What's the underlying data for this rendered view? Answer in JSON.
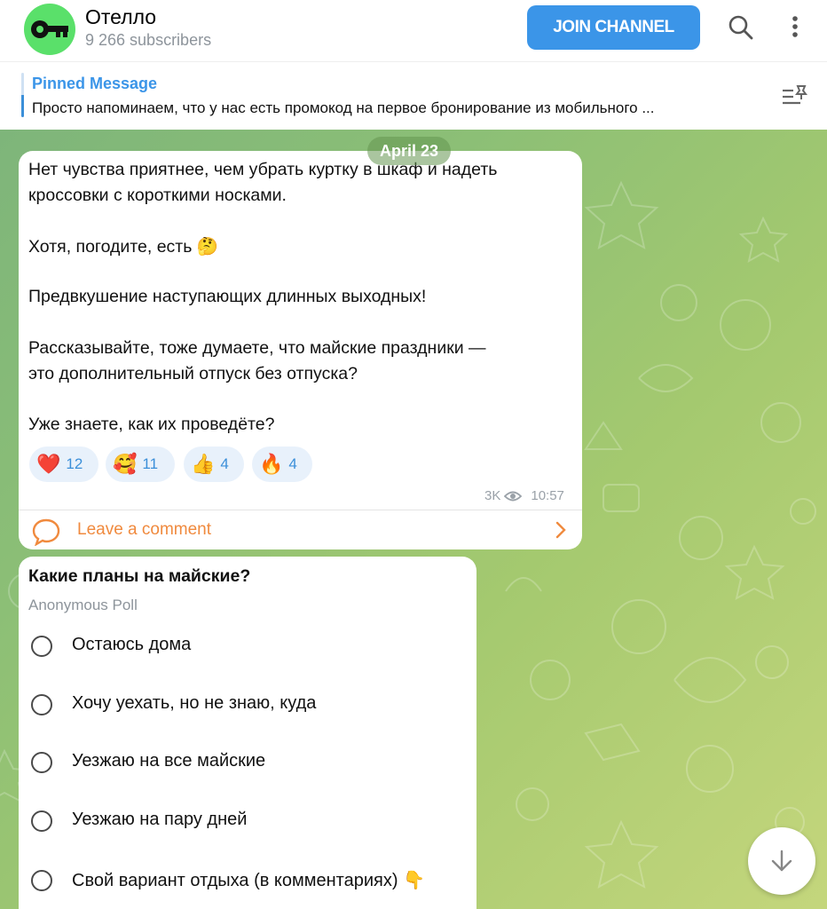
{
  "header": {
    "title": "Отелло",
    "subtitle": "9 266 subscribers",
    "join_label": "JOIN CHANNEL",
    "avatar_icon": "key-icon",
    "search_icon": "search-icon",
    "more_icon": "more-vertical-icon"
  },
  "pinned": {
    "title": "Pinned Message",
    "text": "Просто напоминаем, что у нас есть промокод на первое бронирование из мобильного ...",
    "icon": "pin-list-icon"
  },
  "chat": {
    "date_chip": "April 23",
    "post": {
      "paragraphs": [
        "Нет чувства приятнее, чем убрать куртку в шкаф и надеть",
        "кроссовки с короткими носками.",
        "Хотя, погодите, есть 🤔",
        "Предвкушение наступающих длинных выходных!",
        "Рассказывайте, тоже думаете, что майские праздники —",
        "это дополнительный отпуск без отпуска?",
        "Уже знаете, как их проведёте?"
      ],
      "reactions": [
        {
          "emoji": "❤️",
          "count": "12",
          "icon": "heart-reaction-icon"
        },
        {
          "emoji": "🥰",
          "count": "11",
          "icon": "love-face-reaction-icon"
        },
        {
          "emoji": "👍",
          "count": "4",
          "icon": "thumbs-up-reaction-icon"
        },
        {
          "emoji": "🔥",
          "count": "4",
          "icon": "fire-reaction-icon"
        }
      ],
      "views": "3K",
      "time": "10:57",
      "comment_label": "Leave a comment"
    },
    "poll": {
      "question": "Какие планы на майские?",
      "type": "Anonymous Poll",
      "options": [
        "Остаюсь дома",
        "Хочу уехать, но не знаю, куда",
        "Уезжаю на все майские",
        "Уезжаю на пару дней",
        "Свой вариант отдыха (в комментариях) 👇"
      ]
    }
  },
  "colors": {
    "accent": "#3b95e8",
    "comment": "#f08a3e",
    "avatar": "#5ae06a"
  }
}
